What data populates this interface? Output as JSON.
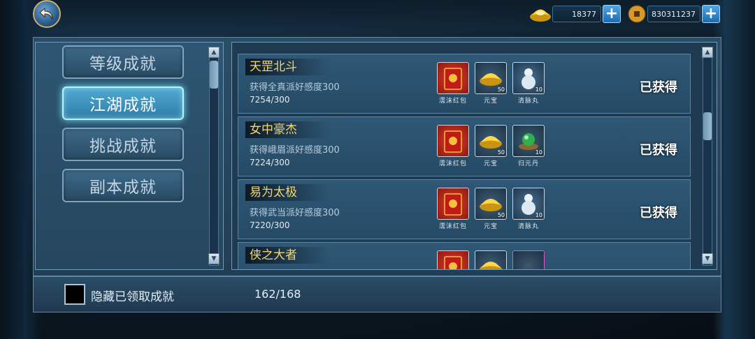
{
  "header": {
    "gold_ingot_amount": "18377",
    "coin_amount": "830311237"
  },
  "categories": [
    {
      "label": "等级成就",
      "active": false
    },
    {
      "label": "江湖成就",
      "active": true
    },
    {
      "label": "挑战成就",
      "active": false
    },
    {
      "label": "副本成就",
      "active": false
    }
  ],
  "achievements": [
    {
      "title": "天罡北斗",
      "desc": "获得全真派好感度300",
      "progress": "7254/300",
      "status": "已获得",
      "rewards": [
        {
          "name": "濡沫红包",
          "icon": "red-envelope-icon",
          "qty": ""
        },
        {
          "name": "元宝",
          "icon": "gold-ingot-icon",
          "qty": "50"
        },
        {
          "name": "清脉丸",
          "icon": "gourd-pill-icon",
          "qty": "10"
        }
      ]
    },
    {
      "title": "女中豪杰",
      "desc": "获得峨眉派好感度300",
      "progress": "7224/300",
      "status": "已获得",
      "rewards": [
        {
          "name": "濡沫红包",
          "icon": "red-envelope-icon",
          "qty": ""
        },
        {
          "name": "元宝",
          "icon": "gold-ingot-icon",
          "qty": "50"
        },
        {
          "name": "归元丹",
          "icon": "green-pill-icon",
          "qty": "10"
        }
      ]
    },
    {
      "title": "易为太极",
      "desc": "获得武当派好感度300",
      "progress": "7220/300",
      "status": "已获得",
      "rewards": [
        {
          "name": "濡沫红包",
          "icon": "red-envelope-icon",
          "qty": ""
        },
        {
          "name": "元宝",
          "icon": "gold-ingot-icon",
          "qty": "50"
        },
        {
          "name": "清脉丸",
          "icon": "gourd-pill-icon",
          "qty": "10"
        }
      ]
    },
    {
      "title": "侠之大者",
      "desc": "",
      "progress": "",
      "status": "",
      "rewards": [
        {
          "name": "",
          "icon": "red-envelope-icon",
          "qty": ""
        },
        {
          "name": "",
          "icon": "gold-ingot-icon",
          "qty": ""
        },
        {
          "name": "",
          "icon": "purple-item-icon",
          "qty": ""
        }
      ]
    }
  ],
  "footer": {
    "hide_claimed_label": "隐藏已领取成就",
    "count": "162/168"
  }
}
